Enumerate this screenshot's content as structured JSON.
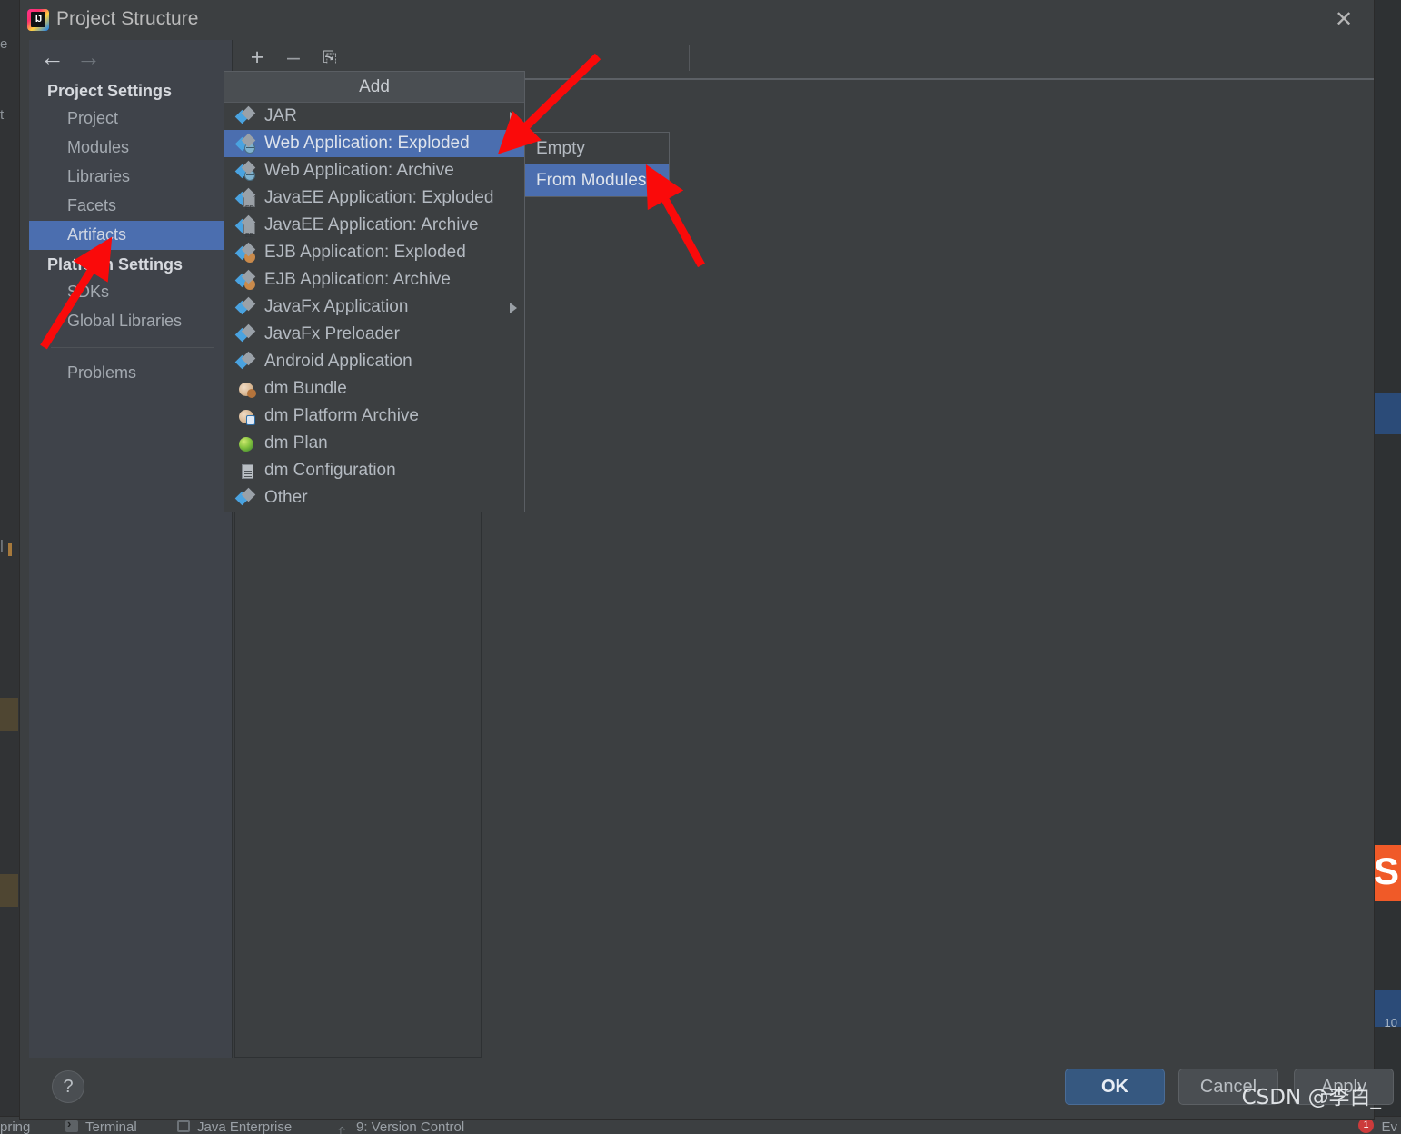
{
  "window": {
    "title": "Project Structure",
    "logo_icon": "intellij-idea-logo",
    "close_icon": "close-icon"
  },
  "nav": {
    "back_icon": "arrow-left-icon",
    "forward_icon": "arrow-right-icon",
    "groups": [
      {
        "title": "Project Settings",
        "items": [
          {
            "label": "Project",
            "selected": false
          },
          {
            "label": "Modules",
            "selected": false
          },
          {
            "label": "Libraries",
            "selected": false
          },
          {
            "label": "Facets",
            "selected": false
          },
          {
            "label": "Artifacts",
            "selected": true
          }
        ]
      },
      {
        "title": "Platform Settings",
        "items": [
          {
            "label": "SDKs",
            "selected": false
          },
          {
            "label": "Global Libraries",
            "selected": false
          }
        ]
      }
    ],
    "extra_items": [
      {
        "label": "Problems",
        "selected": false
      }
    ]
  },
  "toolbar": {
    "add_icon": "plus-icon",
    "remove_icon": "minus-icon",
    "copy_icon": "copy-icon",
    "add_glyph": "+",
    "remove_glyph": "–",
    "copy_glyph": "⎘"
  },
  "menu": {
    "header": "Add",
    "items": [
      {
        "label": "JAR",
        "icon": "diamonds-icon",
        "submenu": true,
        "selected": false
      },
      {
        "label": "Web Application: Exploded",
        "icon": "web-app-icon",
        "submenu": true,
        "selected": true
      },
      {
        "label": "Web Application: Archive",
        "icon": "web-app-icon",
        "submenu": false,
        "selected": false
      },
      {
        "label": "JavaEE Application: Exploded",
        "icon": "javaee-app-icon",
        "submenu": false,
        "selected": false
      },
      {
        "label": "JavaEE Application: Archive",
        "icon": "javaee-app-icon",
        "submenu": false,
        "selected": false
      },
      {
        "label": "EJB Application: Exploded",
        "icon": "ejb-app-icon",
        "submenu": false,
        "selected": false
      },
      {
        "label": "EJB Application: Archive",
        "icon": "ejb-app-icon",
        "submenu": false,
        "selected": false
      },
      {
        "label": "JavaFx Application",
        "icon": "diamonds-icon",
        "submenu": true,
        "selected": false
      },
      {
        "label": "JavaFx Preloader",
        "icon": "diamonds-icon",
        "submenu": false,
        "selected": false
      },
      {
        "label": "Android Application",
        "icon": "diamonds-icon",
        "submenu": false,
        "selected": false
      },
      {
        "label": "dm Bundle",
        "icon": "dm-bundle-icon",
        "submenu": false,
        "selected": false
      },
      {
        "label": "dm Platform Archive",
        "icon": "dm-platform-icon",
        "submenu": false,
        "selected": false
      },
      {
        "label": "dm Plan",
        "icon": "dm-plan-icon",
        "submenu": false,
        "selected": false
      },
      {
        "label": "dm Configuration",
        "icon": "dm-config-icon",
        "submenu": false,
        "selected": false
      },
      {
        "label": "Other",
        "icon": "diamonds-icon",
        "submenu": false,
        "selected": false
      }
    ]
  },
  "submenu": {
    "items": [
      {
        "label": "Empty",
        "selected": false
      },
      {
        "label": "From Modules...",
        "selected": true
      }
    ]
  },
  "footer": {
    "help_icon": "question-mark-icon",
    "help_label": "?",
    "ok_label": "OK",
    "cancel_label": "Cancel",
    "apply_label": "Apply",
    "apply_mnemonic": "A",
    "apply_rest": "pply"
  },
  "watermark": {
    "text": "CSDN @李白_"
  },
  "background_ide": {
    "statusbar": [
      {
        "label": "pring",
        "icon": ""
      },
      {
        "label": "Terminal",
        "icon": "terminal-icon"
      },
      {
        "label": "Java Enterprise",
        "icon": "java-enterprise-icon"
      },
      {
        "label": "9: Version Control",
        "icon": "version-control-icon"
      }
    ],
    "notification_count": "1",
    "right_edge_icon": "orange-app-icon"
  },
  "colors": {
    "accent_selection": "#4b6eaf",
    "dialog_bg": "#3c3f41",
    "nav_bg": "#3f434a",
    "text": "#b4bac1",
    "ok_button": "#365880",
    "annotation_arrow": "#fa0a0a"
  }
}
